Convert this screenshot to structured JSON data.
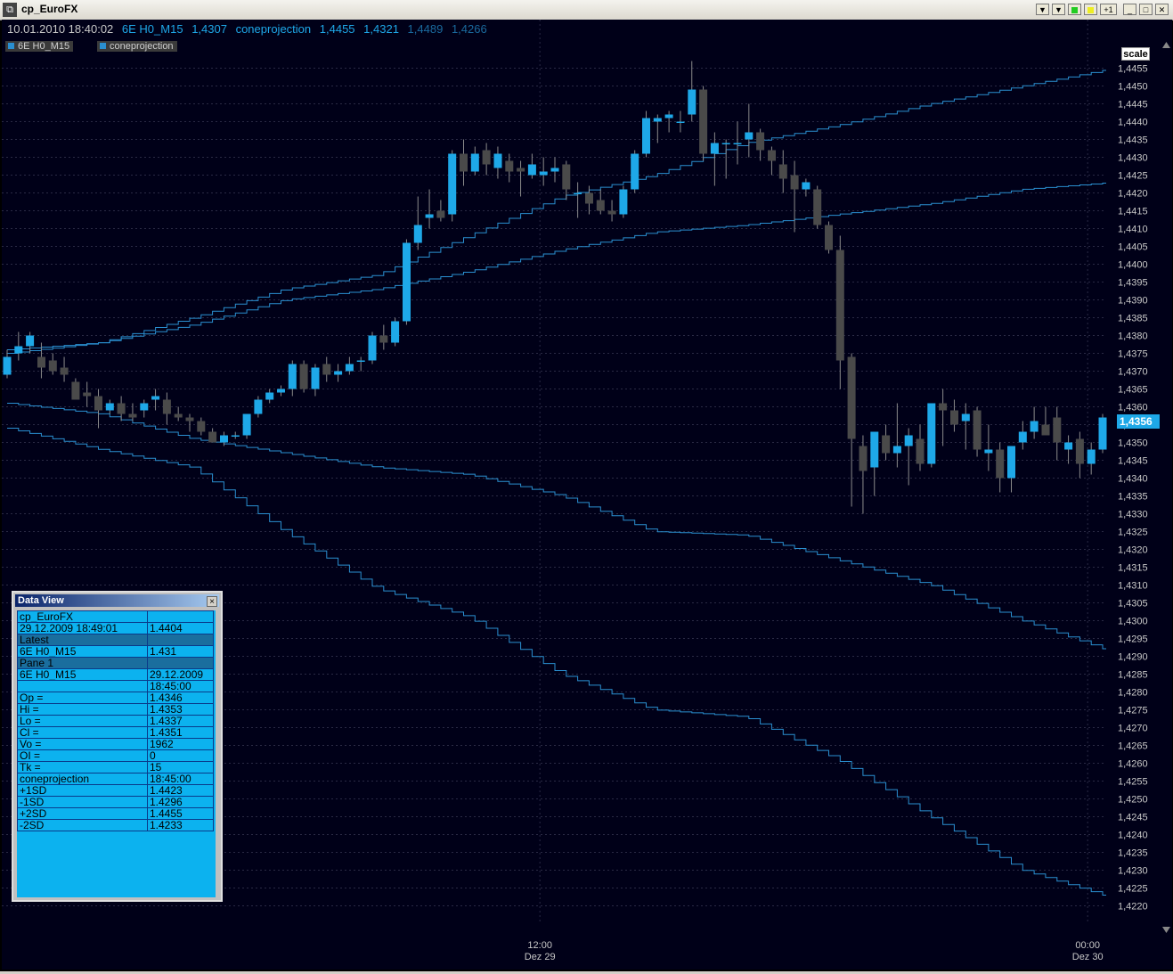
{
  "window": {
    "title": "cp_EuroFX",
    "icon": "chart-app-icon",
    "buttons": [
      {
        "name": "scroll-down-button",
        "label": "▼"
      },
      {
        "name": "scroll-down-button-2",
        "label": "▼"
      },
      {
        "name": "green-indicator-button",
        "label": ""
      },
      {
        "name": "yellow-indicator-button",
        "label": ""
      },
      {
        "name": "plus-one-button",
        "label": "+1"
      },
      {
        "name": "minimize-button",
        "label": "_"
      },
      {
        "name": "maximize-button",
        "label": "□"
      },
      {
        "name": "close-button",
        "label": "✕"
      }
    ]
  },
  "header": {
    "datetime": "10.01.2010 18:40:02",
    "symbol": "6E H0_M15",
    "price": "1,4307",
    "indicator": "coneprojection",
    "values": [
      "1,4455",
      "1,4321",
      "1,4489",
      "1,4266"
    ]
  },
  "tags": [
    "6E H0_M15",
    "coneprojection"
  ],
  "scale_label": "scale",
  "last_price": "1,4356",
  "colors": {
    "background": "#000018",
    "up_candle": "#1ea8e8",
    "down_candle": "#4a4a4a",
    "cone_line": "#2a8fd0",
    "grid": "#2a2a44",
    "axis_text": "#c8c8c8"
  },
  "chart_data": {
    "type": "candlestick",
    "y_ticks": [
      "1,4455",
      "1,4450",
      "1,4445",
      "1,4440",
      "1,4435",
      "1,4430",
      "1,4425",
      "1,4420",
      "1,4415",
      "1,4410",
      "1,4405",
      "1,4400",
      "1,4395",
      "1,4390",
      "1,4385",
      "1,4380",
      "1,4375",
      "1,4370",
      "1,4365",
      "1,4360",
      "1,4355",
      "1,4350",
      "1,4345",
      "1,4340",
      "1,4335",
      "1,4330",
      "1,4325",
      "1,4320",
      "1,4315",
      "1,4310",
      "1,4305",
      "1,4300",
      "1,4295",
      "1,4290",
      "1,4285",
      "1,4280",
      "1,4275",
      "1,4270",
      "1,4265",
      "1,4260",
      "1,4255",
      "1,4250",
      "1,4245",
      "1,4240",
      "1,4235",
      "1,4230",
      "1,4225",
      "1,4220"
    ],
    "x_ticks": [
      {
        "time": "12:00",
        "date": "Dez 29",
        "bar": 47
      },
      {
        "time": "00:00",
        "date": "Dez 30",
        "bar": 95
      }
    ],
    "ylim": [
      1.4215,
      1.4462
    ],
    "candles": [
      [
        1.4369,
        1.4376,
        1.4368,
        1.4374
      ],
      [
        1.4375,
        1.4381,
        1.4373,
        1.4377
      ],
      [
        1.4377,
        1.4381,
        1.4375,
        1.438
      ],
      [
        1.4374,
        1.4378,
        1.4368,
        1.4371
      ],
      [
        1.4373,
        1.4375,
        1.4369,
        1.437
      ],
      [
        1.4371,
        1.4374,
        1.4367,
        1.4369
      ],
      [
        1.4367,
        1.4368,
        1.4362,
        1.4362
      ],
      [
        1.4364,
        1.4367,
        1.436,
        1.4363
      ],
      [
        1.4363,
        1.4365,
        1.4354,
        1.4359
      ],
      [
        1.4359,
        1.4362,
        1.4358,
        1.4361
      ],
      [
        1.4361,
        1.4363,
        1.4356,
        1.4358
      ],
      [
        1.4358,
        1.4361,
        1.4356,
        1.4357
      ],
      [
        1.4359,
        1.4362,
        1.4357,
        1.4361
      ],
      [
        1.4362,
        1.4365,
        1.4359,
        1.4363
      ],
      [
        1.4362,
        1.4364,
        1.4355,
        1.4358
      ],
      [
        1.4358,
        1.436,
        1.4356,
        1.4357
      ],
      [
        1.4357,
        1.4358,
        1.4353,
        1.4356
      ],
      [
        1.4356,
        1.4357,
        1.4352,
        1.4353
      ],
      [
        1.4353,
        1.4354,
        1.435,
        1.435
      ],
      [
        1.435,
        1.4353,
        1.4349,
        1.4352
      ],
      [
        1.4352,
        1.4353,
        1.4351,
        1.4352
      ],
      [
        1.4352,
        1.4358,
        1.4351,
        1.4358
      ],
      [
        1.4358,
        1.4363,
        1.4357,
        1.4362
      ],
      [
        1.4362,
        1.4365,
        1.4361,
        1.4364
      ],
      [
        1.4364,
        1.4366,
        1.4363,
        1.4365
      ],
      [
        1.4365,
        1.4373,
        1.4363,
        1.4372
      ],
      [
        1.4372,
        1.4373,
        1.4364,
        1.4365
      ],
      [
        1.4365,
        1.4372,
        1.4363,
        1.4371
      ],
      [
        1.4372,
        1.4374,
        1.4367,
        1.4369
      ],
      [
        1.4369,
        1.4372,
        1.4367,
        1.437
      ],
      [
        1.437,
        1.4374,
        1.4369,
        1.4372
      ],
      [
        1.4373,
        1.4374,
        1.437,
        1.4373
      ],
      [
        1.4373,
        1.4381,
        1.4372,
        1.438
      ],
      [
        1.438,
        1.4383,
        1.4376,
        1.4378
      ],
      [
        1.4378,
        1.4385,
        1.4377,
        1.4384
      ],
      [
        1.4384,
        1.4407,
        1.4383,
        1.4406
      ],
      [
        1.4406,
        1.4419,
        1.4404,
        1.4411
      ],
      [
        1.4413,
        1.4421,
        1.441,
        1.4414
      ],
      [
        1.4415,
        1.4418,
        1.4412,
        1.4413
      ],
      [
        1.4414,
        1.4432,
        1.4412,
        1.4431
      ],
      [
        1.4431,
        1.4435,
        1.4422,
        1.4426
      ],
      [
        1.4426,
        1.4433,
        1.4425,
        1.4431
      ],
      [
        1.4432,
        1.4434,
        1.4425,
        1.4428
      ],
      [
        1.4427,
        1.4433,
        1.4424,
        1.4431
      ],
      [
        1.4429,
        1.4431,
        1.4423,
        1.4426
      ],
      [
        1.4427,
        1.4429,
        1.4419,
        1.4426
      ],
      [
        1.4425,
        1.4431,
        1.4424,
        1.4428
      ],
      [
        1.4425,
        1.443,
        1.4422,
        1.4426
      ],
      [
        1.4426,
        1.443,
        1.4423,
        1.4427
      ],
      [
        1.4428,
        1.4429,
        1.4418,
        1.4421
      ],
      [
        1.442,
        1.4423,
        1.4413,
        1.442
      ],
      [
        1.442,
        1.4422,
        1.4414,
        1.4417
      ],
      [
        1.4418,
        1.4421,
        1.4414,
        1.4415
      ],
      [
        1.4415,
        1.4418,
        1.4412,
        1.4414
      ],
      [
        1.4414,
        1.4422,
        1.4413,
        1.4421
      ],
      [
        1.4421,
        1.4432,
        1.442,
        1.4431
      ],
      [
        1.4431,
        1.4443,
        1.443,
        1.4441
      ],
      [
        1.444,
        1.4442,
        1.4434,
        1.4441
      ],
      [
        1.4441,
        1.4443,
        1.4437,
        1.4442
      ],
      [
        1.444,
        1.4443,
        1.4437,
        1.444
      ],
      [
        1.4442,
        1.4457,
        1.444,
        1.4449
      ],
      [
        1.4449,
        1.445,
        1.4429,
        1.4431
      ],
      [
        1.4431,
        1.4437,
        1.4422,
        1.4434
      ],
      [
        1.4434,
        1.4435,
        1.4424,
        1.4434
      ],
      [
        1.4434,
        1.444,
        1.4428,
        1.4434
      ],
      [
        1.4435,
        1.4445,
        1.443,
        1.4437
      ],
      [
        1.4437,
        1.4438,
        1.4429,
        1.4432
      ],
      [
        1.4432,
        1.4433,
        1.4425,
        1.4429
      ],
      [
        1.4428,
        1.4432,
        1.442,
        1.4424
      ],
      [
        1.4425,
        1.4429,
        1.4409,
        1.4421
      ],
      [
        1.4421,
        1.4424,
        1.4419,
        1.4423
      ],
      [
        1.4421,
        1.4422,
        1.441,
        1.4411
      ],
      [
        1.4411,
        1.4412,
        1.4403,
        1.4404
      ],
      [
        1.4404,
        1.4408,
        1.4365,
        1.4373
      ],
      [
        1.4374,
        1.4375,
        1.4332,
        1.4351
      ],
      [
        1.4349,
        1.4352,
        1.433,
        1.4342
      ],
      [
        1.4343,
        1.4353,
        1.4335,
        1.4353
      ],
      [
        1.4352,
        1.4355,
        1.4345,
        1.4347
      ],
      [
        1.4347,
        1.4361,
        1.4343,
        1.4349
      ],
      [
        1.4349,
        1.4354,
        1.4338,
        1.4352
      ],
      [
        1.4351,
        1.4355,
        1.4342,
        1.4344
      ],
      [
        1.4344,
        1.4361,
        1.4343,
        1.4361
      ],
      [
        1.4361,
        1.4365,
        1.4349,
        1.4359
      ],
      [
        1.4359,
        1.4362,
        1.4353,
        1.4355
      ],
      [
        1.4356,
        1.4361,
        1.4348,
        1.4358
      ],
      [
        1.4359,
        1.436,
        1.4346,
        1.4348
      ],
      [
        1.4347,
        1.4355,
        1.4342,
        1.4348
      ],
      [
        1.4348,
        1.435,
        1.4336,
        1.434
      ],
      [
        1.434,
        1.4349,
        1.4336,
        1.4349
      ],
      [
        1.435,
        1.4356,
        1.4348,
        1.4353
      ],
      [
        1.4353,
        1.436,
        1.4351,
        1.4356
      ],
      [
        1.4355,
        1.436,
        1.4352,
        1.4352
      ],
      [
        1.4357,
        1.436,
        1.4345,
        1.435
      ],
      [
        1.4348,
        1.4352,
        1.4344,
        1.435
      ],
      [
        1.4351,
        1.4353,
        1.434,
        1.4344
      ],
      [
        1.4344,
        1.435,
        1.4341,
        1.4348
      ],
      [
        1.4348,
        1.4358,
        1.4347,
        1.4357
      ]
    ],
    "cone": {
      "plus2sd": [
        1.4376,
        1.4378,
        1.4385,
        1.4393,
        1.4397,
        1.4408,
        1.4419,
        1.4425,
        1.4434,
        1.4439,
        1.4445,
        1.445,
        1.4455
      ],
      "plus1sd": [
        1.4375,
        1.4378,
        1.4383,
        1.439,
        1.4393,
        1.4398,
        1.4404,
        1.4409,
        1.4411,
        1.4414,
        1.4417,
        1.4421,
        1.4423
      ],
      "minus1sd": [
        1.4361,
        1.4358,
        1.4351,
        1.4347,
        1.4343,
        1.4341,
        1.4335,
        1.4325,
        1.4324,
        1.4317,
        1.431,
        1.43,
        1.4291
      ],
      "minus2sd": [
        1.4354,
        1.4348,
        1.4343,
        1.4325,
        1.4309,
        1.4301,
        1.4285,
        1.4275,
        1.4273,
        1.4261,
        1.4245,
        1.423,
        1.4222
      ]
    }
  },
  "data_view": {
    "title": "Data View",
    "rows": [
      {
        "label": "cp_EuroFX",
        "value": "",
        "hl": false
      },
      {
        "label": "29.12.2009 18:49:01",
        "value": "1.4404",
        "hl": false
      },
      {
        "label": "Latest",
        "value": "",
        "hl": true
      },
      {
        "label": "6E H0_M15",
        "value": "1.431",
        "hl": false
      },
      {
        "label": "Pane 1",
        "value": "",
        "hl": true
      },
      {
        "label": "6E H0_M15",
        "value": "29.12.2009",
        "hl": false
      },
      {
        "label": "",
        "value": "18:45:00",
        "hl": false
      },
      {
        "label": "Op =",
        "value": "1.4346",
        "hl": false
      },
      {
        "label": "Hi =",
        "value": "1.4353",
        "hl": false
      },
      {
        "label": "Lo =",
        "value": "1.4337",
        "hl": false
      },
      {
        "label": "Cl =",
        "value": "1.4351",
        "hl": false
      },
      {
        "label": "Vo =",
        "value": "1962",
        "hl": false
      },
      {
        "label": "OI =",
        "value": "0",
        "hl": false
      },
      {
        "label": "Tk =",
        "value": "15",
        "hl": false
      },
      {
        "label": "coneprojection",
        "value": "18:45:00",
        "hl": false
      },
      {
        "label": "+1SD",
        "value": "1.4423",
        "hl": false
      },
      {
        "label": "-1SD",
        "value": "1.4296",
        "hl": false
      },
      {
        "label": "+2SD",
        "value": "1.4455",
        "hl": false
      },
      {
        "label": "-2SD",
        "value": "1.4233",
        "hl": false
      }
    ]
  }
}
